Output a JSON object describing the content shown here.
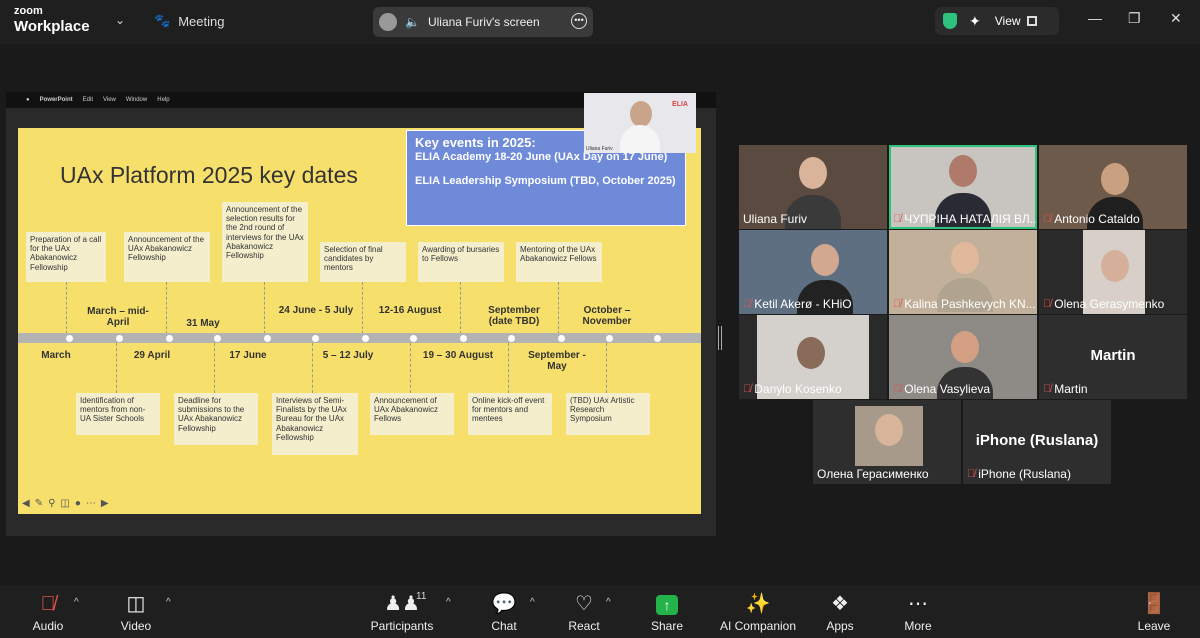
{
  "app": {
    "brand_line1": "zoom",
    "brand_line2": "Workplace",
    "meeting_label": "Meeting",
    "share_label": "Uliana Furiv's screen",
    "view_label": "View"
  },
  "colors": {
    "accent_green": "#2ec27e",
    "share_green": "#24b24b",
    "mute_red": "#e5534b",
    "slide_yellow": "#f6df6a",
    "keybox_blue": "#6f8ad8"
  },
  "slide": {
    "menubar": [
      "PowerPoint",
      "Edit",
      "View",
      "Window",
      "Help"
    ],
    "title": "UAx Platform 2025 key dates",
    "key_events": {
      "heading": "Key events in 2025:",
      "line1": "ELIA Academy 18-20 June (UAx Day on 17 June)",
      "line2": "ELIA Leadership Symposium (TBD, October 2025)"
    },
    "presenter_name": "Uliana Furiv",
    "presenter_logo": "ELIA",
    "top_notes": [
      "Preparation of a call for the UAx Abakanowicz Fellowship",
      "Announcement of the UAx Abakanowicz Fellowship",
      "Announcement of the selection results for the 2nd round of interviews for the UAx Abakanowicz Fellowship",
      "Selection of final candidates by mentors",
      "Awarding of bursaries to Fellows",
      "Mentoring of the UAx Abakanowicz Fellows"
    ],
    "upper_dates": [
      "March – mid-April",
      "31 May",
      "24 June - 5 July",
      "12-16 August",
      "September (date TBD)",
      "October – November"
    ],
    "lower_dates": [
      "March",
      "29 April",
      "17 June",
      "5 – 12 July",
      "19 – 30 August",
      "September - May"
    ],
    "bottom_notes": [
      "Identification of mentors from non-UA Sister Schools",
      "Deadline for submissions to the UAx Abakanowicz Fellowship",
      "Interviews of Semi-Finalists by the UAx Bureau for the UAx Abakanowicz Fellowship",
      "Announcement of UAx Abakanowicz Fellows",
      "Online kick-off event for mentors and mentees",
      "(TBD) UAx Artistic Research Symposium"
    ]
  },
  "participants": [
    {
      "name": "Uliana Furiv",
      "muted": false
    },
    {
      "name": "ЧУПРІНА НАТАЛІЯ ВЛ...",
      "muted": true
    },
    {
      "name": "Antonio Cataldo",
      "muted": true
    },
    {
      "name": "Ketil Akerø - KHiO",
      "muted": true
    },
    {
      "name": "Kalina Pashkevych KN...",
      "muted": true
    },
    {
      "name": "Olena Gerasymenko",
      "muted": true
    },
    {
      "name": "Danylo Kosenko",
      "muted": true
    },
    {
      "name": "Olena Vasylieva",
      "muted": true
    },
    {
      "name": "Martin",
      "muted": true,
      "display_name": "Martin"
    },
    {
      "name": "Олена Герасименко",
      "muted": false
    },
    {
      "name": "iPhone (Ruslana)",
      "muted": true,
      "display_name": "iPhone (Ruslana)"
    }
  ],
  "toolbar": {
    "audio": "Audio",
    "video": "Video",
    "participants": "Participants",
    "participants_count": "11",
    "chat": "Chat",
    "react": "React",
    "share": "Share",
    "ai_companion": "AI Companion",
    "apps": "Apps",
    "more": "More",
    "leave": "Leave"
  }
}
